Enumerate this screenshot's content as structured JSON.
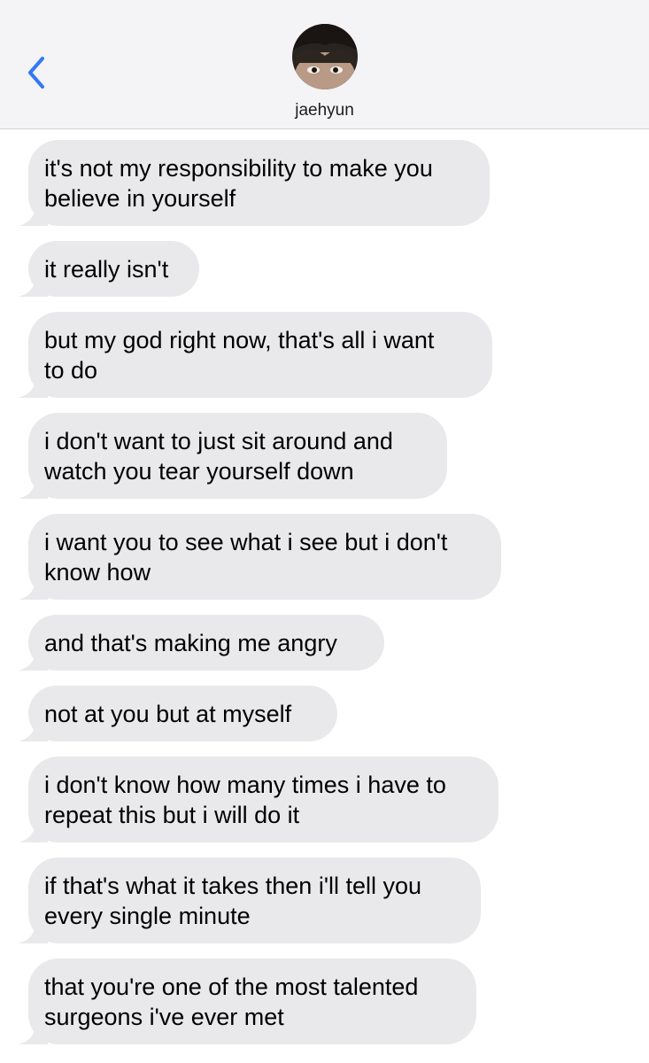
{
  "header": {
    "contact_name": "jaehyun",
    "back_icon": "chevron-left-icon",
    "avatar": "contact-avatar-photo"
  },
  "colors": {
    "header_bg": "#f4f4f6",
    "accent": "#3478f6",
    "bubble_bg": "#e9e9eb",
    "text": "#000000"
  },
  "messages": [
    {
      "text": "it's not my responsibility to make you\nbelieve in yourself"
    },
    {
      "text": "it really isn't"
    },
    {
      "text": "but my god right now, that's all i want\nto do"
    },
    {
      "text": "i don't want to just sit around and\nwatch you tear yourself down"
    },
    {
      "text": "i want you to see what i see but i don't\nknow how"
    },
    {
      "text": "and that's making me angry"
    },
    {
      "text": "not at you but at myself"
    },
    {
      "text": "i don't know how many times i have to\nrepeat this but i will do it"
    },
    {
      "text": "if that's what it takes then i'll tell you\nevery single minute"
    },
    {
      "text": "that you're one of the most talented\nsurgeons i've ever met"
    }
  ]
}
